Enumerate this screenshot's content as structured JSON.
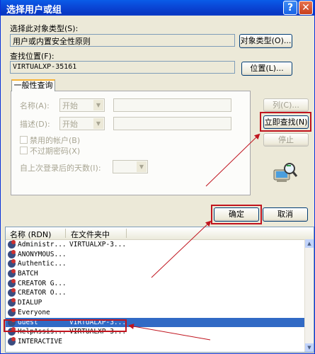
{
  "title": "选择用户或组",
  "help_glyph": "?",
  "close_glyph": "✕",
  "object_type": {
    "label": "选择此对象类型(S):",
    "value": "用户或内置安全性原则",
    "button": "对象类型(O)..."
  },
  "location": {
    "label": "查找位置(F):",
    "value": "VIRTUALXP-35161",
    "button": "位置(L)..."
  },
  "tab": "一般性查询",
  "query": {
    "name_label": "名称(A):",
    "desc_label": "描述(D):",
    "starts_with": "开始",
    "disabled_accounts": "禁用的帐户(B)",
    "no_expire_pwd": "不过期密码(X)",
    "days_since_logon": "自上次登录后的天数(I):"
  },
  "side_buttons": {
    "columns": "列(C)...",
    "find_now": "立即查找(N)",
    "stop": "停止"
  },
  "ok": "确定",
  "cancel": "取消",
  "results": {
    "col_name": "名称 (RDN)",
    "col_folder": "在文件夹中",
    "rows": [
      {
        "name": "Administr...",
        "folder": "VIRTUALXP-3..."
      },
      {
        "name": "ANONYMOUS...",
        "folder": ""
      },
      {
        "name": "Authentic...",
        "folder": ""
      },
      {
        "name": "BATCH",
        "folder": ""
      },
      {
        "name": "CREATOR G...",
        "folder": ""
      },
      {
        "name": "CREATOR O...",
        "folder": ""
      },
      {
        "name": "DIALUP",
        "folder": ""
      },
      {
        "name": "Everyone",
        "folder": ""
      },
      {
        "name": "Guest",
        "folder": "VIRTUALXP-3..."
      },
      {
        "name": "HelpAssis...",
        "folder": "VIRTUALXP-3..."
      },
      {
        "name": "INTERACTIVE",
        "folder": ""
      }
    ],
    "selected_index": 8
  },
  "colors": {
    "title_blue": "#0a46d6",
    "highlight_red": "#c0141e",
    "selection_blue": "#316ac5"
  }
}
